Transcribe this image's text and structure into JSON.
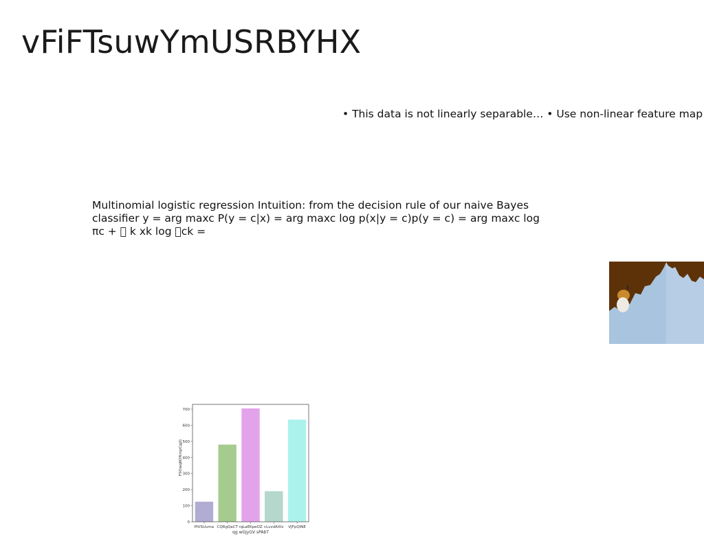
{
  "slide": {
    "title": "vFiFTsuwYmUSRBYHX",
    "bullet_text": "• This data is not linearly separable… • Use non-linear feature map to add",
    "body_text": "Multinomial logistic regression Intuition: from the decision rule of our naive Bayes classifier y = arg maxc P(y = c|x) = arg maxc log p(x|y = c)p(y = c) = arg maxc log πc + \u0000 k xk log \u0000ck ="
  },
  "photo": {
    "description_icon": "mountain-photo-icon",
    "colors": {
      "sky": "#5e3208",
      "mountain": "#a9c4df",
      "object": "#e8e6e0"
    }
  },
  "chart_data": {
    "type": "bar",
    "categories": [
      "PIVSUuma",
      "CQRgQaCT",
      "rqLaEKpeOZ",
      "cLvvdAXIv",
      "VJFpQINE"
    ],
    "values": [
      125,
      480,
      705,
      190,
      635
    ],
    "colors": [
      "#b1acd2",
      "#a5cb8e",
      "#e3a3ea",
      "#b4d8cb",
      "#acf2ec"
    ],
    "title": "",
    "xlabel": "qg wGjyGV sPAbT",
    "ylabel": "FSOwqKOfkrqzCgjG",
    "ylim": [
      0,
      730
    ],
    "yticks": [
      "0",
      "100",
      "200",
      "300",
      "400",
      "500",
      "600",
      "700"
    ],
    "grid": false
  }
}
